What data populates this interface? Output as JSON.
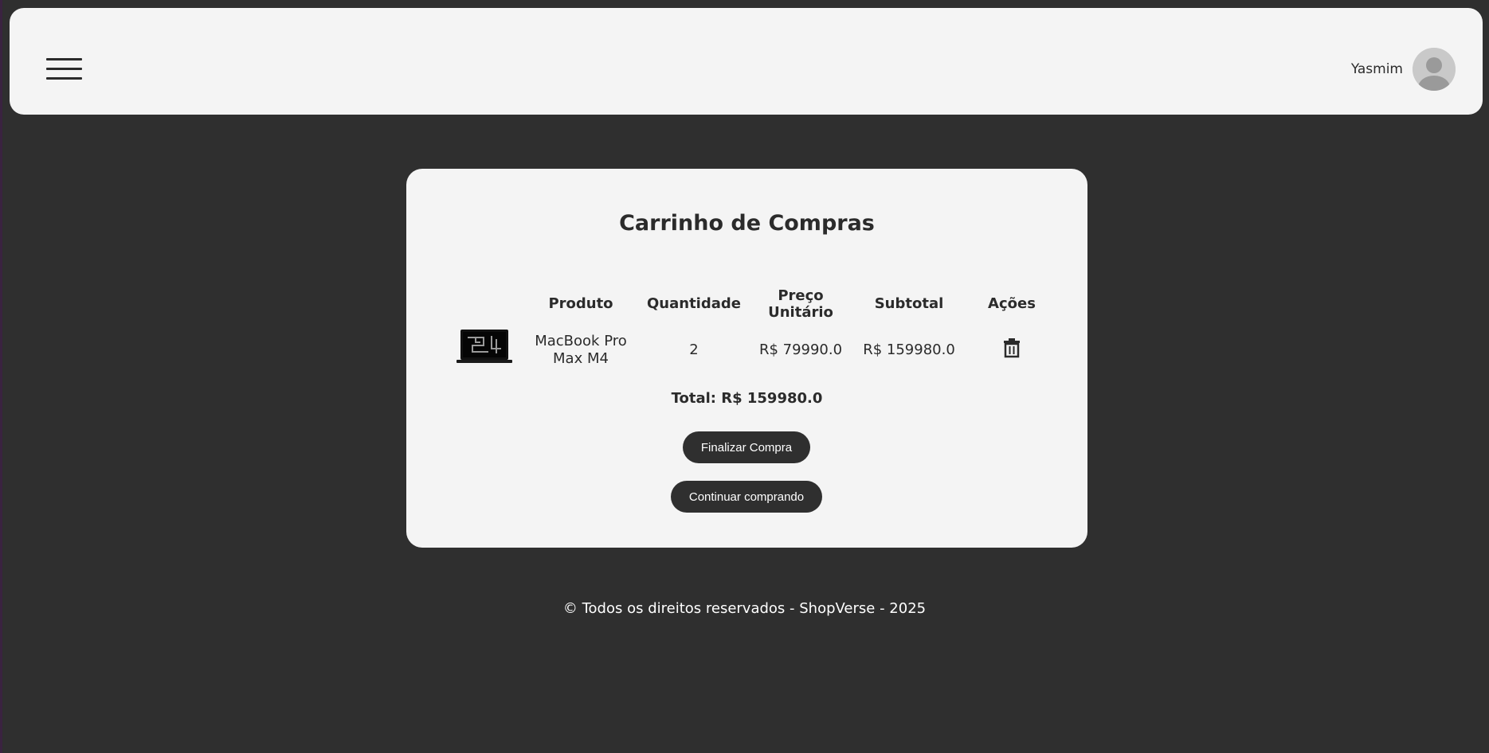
{
  "header": {
    "user_name": "Yasmim"
  },
  "cart": {
    "title": "Carrinho de Compras",
    "columns": {
      "product": "Produto",
      "quantity": "Quantidade",
      "unit_price_line1": "Preço",
      "unit_price_line2": "Unitário",
      "subtotal": "Subtotal",
      "actions": "Ações"
    },
    "items": [
      {
        "name_line1": "MacBook Pro",
        "name_line2": "Max M4",
        "quantity": "2",
        "unit_price": "R$ 79990.0",
        "subtotal": "R$ 159980.0"
      }
    ],
    "total": "Total: R$ 159980.0",
    "finalize_label": "Finalizar Compra",
    "continue_label": "Continuar comprando"
  },
  "footer": {
    "text": "© Todos os direitos reservados - ShopVerse - 2025"
  },
  "icons": {
    "menu": "hamburger-menu-icon",
    "avatar": "user-avatar-icon",
    "delete": "trash-icon",
    "product": "laptop-thumbnail"
  },
  "colors": {
    "page_background": "#2f2f2f",
    "panel_background": "#f4f4f4",
    "text": "#2b2b2b",
    "button_background": "#2f2f2f",
    "button_text": "#ffffff"
  }
}
